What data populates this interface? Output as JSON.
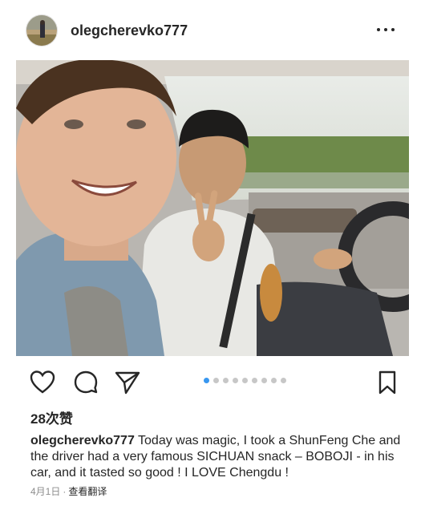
{
  "post": {
    "username": "olegcherevko777",
    "likes": "28次赞",
    "caption_user": "olegcherevko777",
    "caption_text": "Today was magic, I took  a ShunFeng Che  and the driver had a very famous SICHUAN snack – BOBOJI - in his car, and it tasted so good ! I LOVE Chengdu !",
    "date": "4月1日",
    "separator": "·",
    "translate": "查看翻译"
  },
  "carousel": {
    "total": 9,
    "active_index": 0
  },
  "icons": {
    "more": "more-dots-icon",
    "like": "heart-icon",
    "comment": "comment-icon",
    "share": "send-icon",
    "save": "bookmark-icon"
  },
  "colors": {
    "accent": "#3897f0",
    "text": "#262626",
    "muted": "#8e8e8e",
    "dot_inactive": "#c7c7c7"
  }
}
